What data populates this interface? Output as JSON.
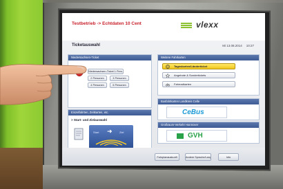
{
  "header": {
    "mode_text": "Testbetrieb -> Echtdaten 10 Cent",
    "brand": "vlexx"
  },
  "title": {
    "label": "Ticketauswahl",
    "date": "Mi 13.08.2014",
    "time": "10:27"
  },
  "left_panel": {
    "heading": "Niedersachsen-Ticket",
    "buttons": [
      "Niedersachsen-Ticket 1 Pers.",
      "2 Personen",
      "3 Personen",
      "4 Personen",
      "5 Personen"
    ]
  },
  "route_panel": {
    "heading": "Einzelfahrten, Zeitkarten, etc.",
    "option": "> Start- und Zielauswahl",
    "start": "Start",
    "ziel": "Ziel"
  },
  "right_panel": {
    "heading": "Weitere Fahrkarten",
    "buttons": [
      "Tageskarten/Länderticket",
      "Angebote & Sondertickets",
      "Fahrradkarten"
    ]
  },
  "cebus_panel": {
    "heading": "Busfahrkarten Landkreis Celle",
    "logo": "CeBus"
  },
  "gvh_panel": {
    "heading": "Großraum-Verkehr Hannover",
    "logo": "GVH"
  },
  "footer": {
    "buttons": [
      "Fahrplanauskunft",
      "Andere Sprache/Language",
      "Info"
    ]
  },
  "colors": {
    "accent": "#3d5a94",
    "selected": "#f0c71a",
    "brand_green": "#8cc232",
    "alert_red": "#c8202a"
  },
  "icons": [
    "coat-of-arms-icon",
    "ticket-icon",
    "globe-icon",
    "star-icon",
    "bicycle-icon",
    "arrow-right-icon"
  ]
}
